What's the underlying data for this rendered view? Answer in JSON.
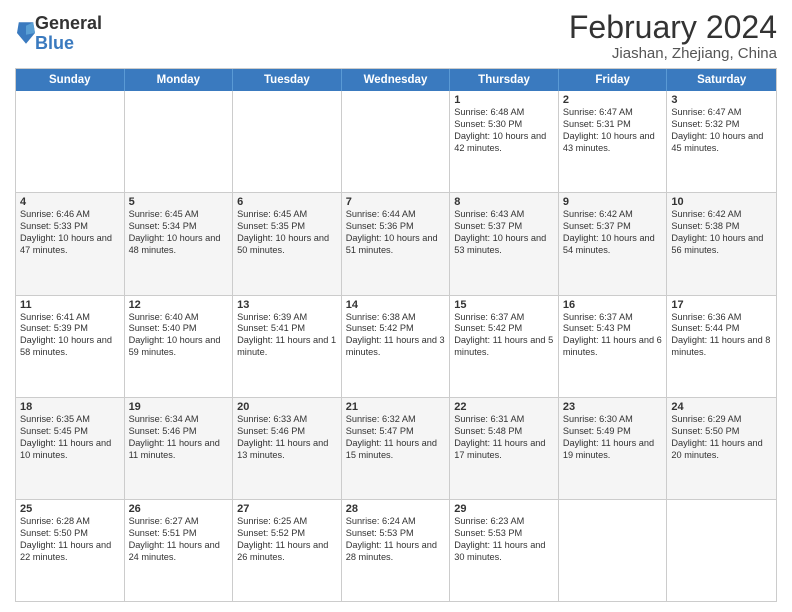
{
  "logo": {
    "general": "General",
    "blue": "Blue"
  },
  "header": {
    "month_year": "February 2024",
    "location": "Jiashan, Zhejiang, China"
  },
  "weekdays": [
    "Sunday",
    "Monday",
    "Tuesday",
    "Wednesday",
    "Thursday",
    "Friday",
    "Saturday"
  ],
  "weeks": [
    [
      {
        "day": "",
        "sunrise": "",
        "sunset": "",
        "daylight": "",
        "empty": true
      },
      {
        "day": "",
        "sunrise": "",
        "sunset": "",
        "daylight": "",
        "empty": true
      },
      {
        "day": "",
        "sunrise": "",
        "sunset": "",
        "daylight": "",
        "empty": true
      },
      {
        "day": "",
        "sunrise": "",
        "sunset": "",
        "daylight": "",
        "empty": true
      },
      {
        "day": "1",
        "sunrise": "Sunrise: 6:48 AM",
        "sunset": "Sunset: 5:30 PM",
        "daylight": "Daylight: 10 hours and 42 minutes.",
        "empty": false
      },
      {
        "day": "2",
        "sunrise": "Sunrise: 6:47 AM",
        "sunset": "Sunset: 5:31 PM",
        "daylight": "Daylight: 10 hours and 43 minutes.",
        "empty": false
      },
      {
        "day": "3",
        "sunrise": "Sunrise: 6:47 AM",
        "sunset": "Sunset: 5:32 PM",
        "daylight": "Daylight: 10 hours and 45 minutes.",
        "empty": false
      }
    ],
    [
      {
        "day": "4",
        "sunrise": "Sunrise: 6:46 AM",
        "sunset": "Sunset: 5:33 PM",
        "daylight": "Daylight: 10 hours and 47 minutes.",
        "empty": false
      },
      {
        "day": "5",
        "sunrise": "Sunrise: 6:45 AM",
        "sunset": "Sunset: 5:34 PM",
        "daylight": "Daylight: 10 hours and 48 minutes.",
        "empty": false
      },
      {
        "day": "6",
        "sunrise": "Sunrise: 6:45 AM",
        "sunset": "Sunset: 5:35 PM",
        "daylight": "Daylight: 10 hours and 50 minutes.",
        "empty": false
      },
      {
        "day": "7",
        "sunrise": "Sunrise: 6:44 AM",
        "sunset": "Sunset: 5:36 PM",
        "daylight": "Daylight: 10 hours and 51 minutes.",
        "empty": false
      },
      {
        "day": "8",
        "sunrise": "Sunrise: 6:43 AM",
        "sunset": "Sunset: 5:37 PM",
        "daylight": "Daylight: 10 hours and 53 minutes.",
        "empty": false
      },
      {
        "day": "9",
        "sunrise": "Sunrise: 6:42 AM",
        "sunset": "Sunset: 5:37 PM",
        "daylight": "Daylight: 10 hours and 54 minutes.",
        "empty": false
      },
      {
        "day": "10",
        "sunrise": "Sunrise: 6:42 AM",
        "sunset": "Sunset: 5:38 PM",
        "daylight": "Daylight: 10 hours and 56 minutes.",
        "empty": false
      }
    ],
    [
      {
        "day": "11",
        "sunrise": "Sunrise: 6:41 AM",
        "sunset": "Sunset: 5:39 PM",
        "daylight": "Daylight: 10 hours and 58 minutes.",
        "empty": false
      },
      {
        "day": "12",
        "sunrise": "Sunrise: 6:40 AM",
        "sunset": "Sunset: 5:40 PM",
        "daylight": "Daylight: 10 hours and 59 minutes.",
        "empty": false
      },
      {
        "day": "13",
        "sunrise": "Sunrise: 6:39 AM",
        "sunset": "Sunset: 5:41 PM",
        "daylight": "Daylight: 11 hours and 1 minute.",
        "empty": false
      },
      {
        "day": "14",
        "sunrise": "Sunrise: 6:38 AM",
        "sunset": "Sunset: 5:42 PM",
        "daylight": "Daylight: 11 hours and 3 minutes.",
        "empty": false
      },
      {
        "day": "15",
        "sunrise": "Sunrise: 6:37 AM",
        "sunset": "Sunset: 5:42 PM",
        "daylight": "Daylight: 11 hours and 5 minutes.",
        "empty": false
      },
      {
        "day": "16",
        "sunrise": "Sunrise: 6:37 AM",
        "sunset": "Sunset: 5:43 PM",
        "daylight": "Daylight: 11 hours and 6 minutes.",
        "empty": false
      },
      {
        "day": "17",
        "sunrise": "Sunrise: 6:36 AM",
        "sunset": "Sunset: 5:44 PM",
        "daylight": "Daylight: 11 hours and 8 minutes.",
        "empty": false
      }
    ],
    [
      {
        "day": "18",
        "sunrise": "Sunrise: 6:35 AM",
        "sunset": "Sunset: 5:45 PM",
        "daylight": "Daylight: 11 hours and 10 minutes.",
        "empty": false
      },
      {
        "day": "19",
        "sunrise": "Sunrise: 6:34 AM",
        "sunset": "Sunset: 5:46 PM",
        "daylight": "Daylight: 11 hours and 11 minutes.",
        "empty": false
      },
      {
        "day": "20",
        "sunrise": "Sunrise: 6:33 AM",
        "sunset": "Sunset: 5:46 PM",
        "daylight": "Daylight: 11 hours and 13 minutes.",
        "empty": false
      },
      {
        "day": "21",
        "sunrise": "Sunrise: 6:32 AM",
        "sunset": "Sunset: 5:47 PM",
        "daylight": "Daylight: 11 hours and 15 minutes.",
        "empty": false
      },
      {
        "day": "22",
        "sunrise": "Sunrise: 6:31 AM",
        "sunset": "Sunset: 5:48 PM",
        "daylight": "Daylight: 11 hours and 17 minutes.",
        "empty": false
      },
      {
        "day": "23",
        "sunrise": "Sunrise: 6:30 AM",
        "sunset": "Sunset: 5:49 PM",
        "daylight": "Daylight: 11 hours and 19 minutes.",
        "empty": false
      },
      {
        "day": "24",
        "sunrise": "Sunrise: 6:29 AM",
        "sunset": "Sunset: 5:50 PM",
        "daylight": "Daylight: 11 hours and 20 minutes.",
        "empty": false
      }
    ],
    [
      {
        "day": "25",
        "sunrise": "Sunrise: 6:28 AM",
        "sunset": "Sunset: 5:50 PM",
        "daylight": "Daylight: 11 hours and 22 minutes.",
        "empty": false
      },
      {
        "day": "26",
        "sunrise": "Sunrise: 6:27 AM",
        "sunset": "Sunset: 5:51 PM",
        "daylight": "Daylight: 11 hours and 24 minutes.",
        "empty": false
      },
      {
        "day": "27",
        "sunrise": "Sunrise: 6:25 AM",
        "sunset": "Sunset: 5:52 PM",
        "daylight": "Daylight: 11 hours and 26 minutes.",
        "empty": false
      },
      {
        "day": "28",
        "sunrise": "Sunrise: 6:24 AM",
        "sunset": "Sunset: 5:53 PM",
        "daylight": "Daylight: 11 hours and 28 minutes.",
        "empty": false
      },
      {
        "day": "29",
        "sunrise": "Sunrise: 6:23 AM",
        "sunset": "Sunset: 5:53 PM",
        "daylight": "Daylight: 11 hours and 30 minutes.",
        "empty": false
      },
      {
        "day": "",
        "sunrise": "",
        "sunset": "",
        "daylight": "",
        "empty": true
      },
      {
        "day": "",
        "sunrise": "",
        "sunset": "",
        "daylight": "",
        "empty": true
      }
    ]
  ],
  "colors": {
    "header_bg": "#3a7abf",
    "header_text": "#ffffff",
    "row_alt": "#f5f5f5",
    "row_normal": "#ffffff",
    "border": "#cccccc",
    "text_main": "#333333"
  }
}
